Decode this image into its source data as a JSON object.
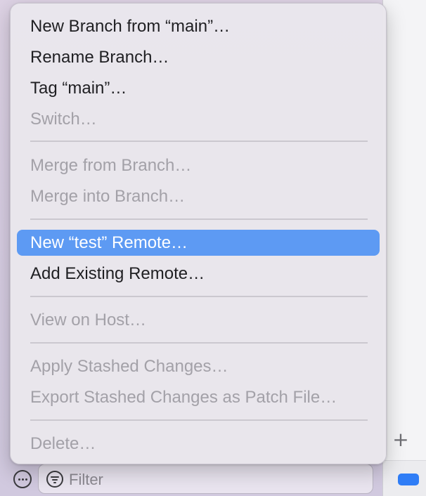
{
  "menu": {
    "items": [
      {
        "label": "New Branch from “main”…",
        "state": "enabled"
      },
      {
        "label": "Rename Branch…",
        "state": "enabled"
      },
      {
        "label": "Tag “main”…",
        "state": "enabled"
      },
      {
        "label": "Switch…",
        "state": "disabled"
      },
      {
        "label": "Merge from Branch…",
        "state": "disabled"
      },
      {
        "label": "Merge into Branch…",
        "state": "disabled"
      },
      {
        "label": "New “test” Remote…",
        "state": "highlighted"
      },
      {
        "label": "Add Existing Remote…",
        "state": "enabled"
      },
      {
        "label": "View on Host…",
        "state": "disabled"
      },
      {
        "label": "Apply Stashed Changes…",
        "state": "disabled"
      },
      {
        "label": "Export Stashed Changes as Patch File…",
        "state": "disabled"
      },
      {
        "label": "Delete…",
        "state": "disabled"
      }
    ]
  },
  "bottom_bar": {
    "filter_placeholder": "Filter"
  },
  "icons": {
    "more": "more-ellipsis-circle-icon",
    "filter": "filter-circle-icon",
    "add": "plus-icon",
    "tag": "blue-tag-icon"
  },
  "colors": {
    "highlight": "#5d9af3",
    "disabled_text": "#a3a1a8",
    "enabled_text": "#1f1f22",
    "tag_blue": "#2f7df6"
  }
}
